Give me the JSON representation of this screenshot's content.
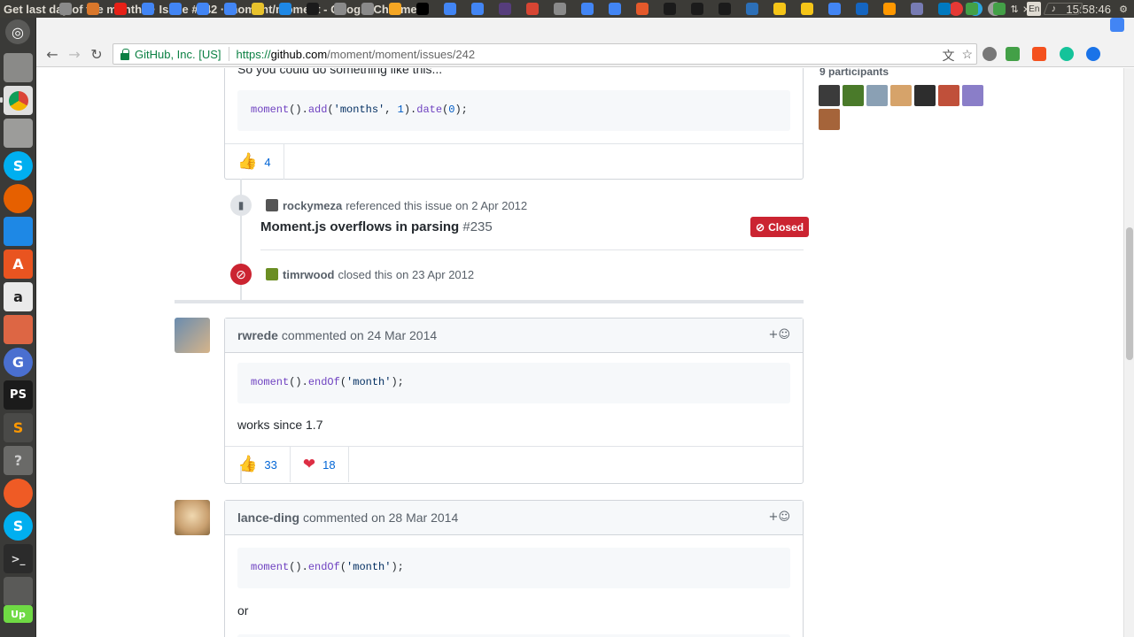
{
  "window": {
    "title": "Get last day of the month? · Issue #242 · moment/moment - Google Chrome",
    "clock": "15:58:46",
    "keyboard": "En"
  },
  "tabs_strip": {
    "colors": [
      "#8a8a8a",
      "#d9772b",
      "#e62117",
      "#4285f4",
      "#4285f4",
      "#4285f4",
      "#4285f4",
      "#e8c22c",
      "#1e88e5",
      "#1b1b1b",
      "#8a8a8a",
      "#8a8a8a",
      "#f5a623",
      "#000000",
      "#4285f4",
      "#4285f4",
      "#563d7c",
      "#d64533",
      "#8a8a8a",
      "#4285f4",
      "#4285f4",
      "#e4592b",
      "#1b1b1b",
      "#1b1b1b",
      "#1b1b1b",
      "#2c6fb7",
      "#f5c518",
      "#f5c518",
      "#4285f4",
      "#1565c0",
      "#ff9800",
      "#777bb3",
      "#0079bf",
      "#43a047",
      "#43a047"
    ],
    "close_glyph": "×"
  },
  "browser": {
    "back_icon": "arrow-left-icon",
    "reload_icon": "reload-icon",
    "security_label": "GitHub, Inc. [US]",
    "url_scheme": "https://",
    "url_host": "github.com",
    "url_path": "/moment/moment/issues/242"
  },
  "sidebar": {
    "participants_label": "9 participants",
    "participant_colors": [
      "#3b3b3b",
      "#4a7a2a",
      "#8aa0b4",
      "#d6a36a",
      "#2d2d2d",
      "#c0503a",
      "#8a7ec8",
      "#a5643a"
    ]
  },
  "first_comment": {
    "intro_text": "So you could do something like this...",
    "code": {
      "fn1": "moment",
      "p1": "().",
      "fn2": "add",
      "p2": "(",
      "str1": "'months'",
      "p3": ", ",
      "num1": "1",
      "p4": ").",
      "fn3": "date",
      "p5": "(",
      "num2": "0",
      "p6": ");"
    },
    "reactions": [
      {
        "emoji": "👍",
        "count": "4"
      }
    ]
  },
  "events": [
    {
      "icon": "bookmark-icon",
      "user": "rockymeza",
      "text": "referenced this issue",
      "date": "on 2 Apr 2012",
      "ref_title": "Moment.js overflows in parsing",
      "ref_number": "#235",
      "state": "Closed"
    },
    {
      "icon": "circle-slash-icon",
      "user": "timrwood",
      "text": "closed this",
      "date": "on 23 Apr 2012"
    }
  ],
  "comments": [
    {
      "author": "rwrede",
      "action": "commented",
      "date": "on 24 Mar 2014",
      "add_reaction": "+☺",
      "code": {
        "fn1": "moment",
        "p1": "().",
        "fn2": "endOf",
        "p2": "(",
        "str1": "'month'",
        "p3": ");"
      },
      "text": "works since 1.7",
      "reactions": [
        {
          "emoji": "👍",
          "count": "33"
        },
        {
          "emoji": "❤",
          "count": "18"
        }
      ]
    },
    {
      "author": "lance-ding",
      "action": "commented",
      "date": "on 28 Mar 2014",
      "add_reaction": "+☺",
      "code": {
        "fn1": "moment",
        "p1": "().",
        "fn2": "endOf",
        "p2": "(",
        "str1": "'month'",
        "p3": ");"
      },
      "text": "or"
    }
  ]
}
